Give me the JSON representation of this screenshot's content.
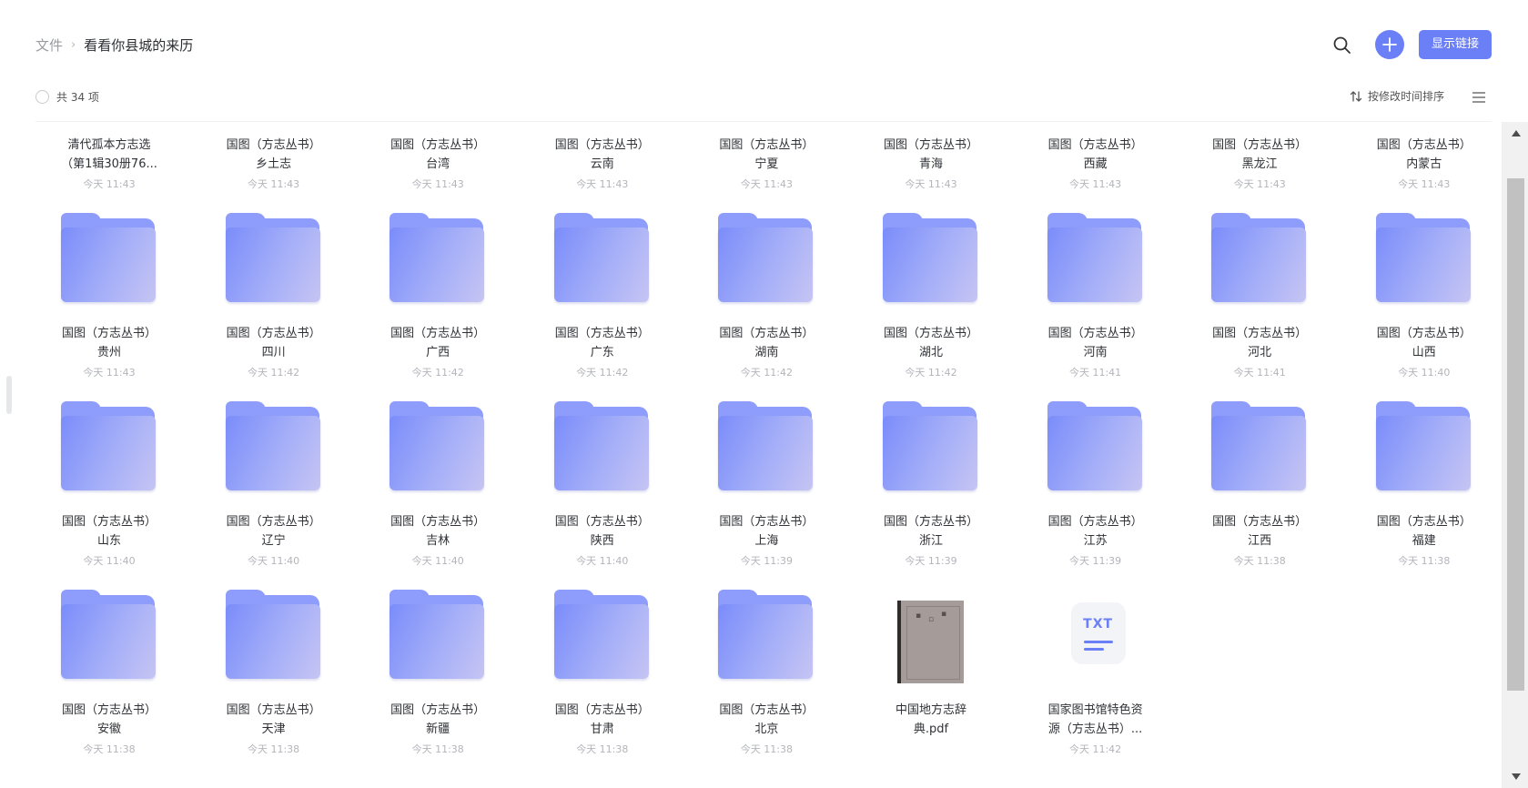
{
  "breadcrumb": {
    "root": "文件",
    "separator": "›",
    "current": "看看你县城的来历"
  },
  "toolbar": {
    "add_symbol": "+",
    "show_link_label": "显示链接",
    "accent": "#6b7ff7"
  },
  "list_header": {
    "count_text": "共 34 项",
    "sort_label": "按修改时间排序"
  },
  "items": [
    {
      "type": "folder",
      "line1": "清代孤本方志选",
      "line2": "（第1辑30册76...",
      "time": "今天 11:43"
    },
    {
      "type": "folder",
      "line1": "国图（方志丛书）",
      "line2": "乡土志",
      "time": "今天 11:43"
    },
    {
      "type": "folder",
      "line1": "国图（方志丛书）",
      "line2": "台湾",
      "time": "今天 11:43"
    },
    {
      "type": "folder",
      "line1": "国图（方志丛书）",
      "line2": "云南",
      "time": "今天 11:43"
    },
    {
      "type": "folder",
      "line1": "国图（方志丛书）",
      "line2": "宁夏",
      "time": "今天 11:43"
    },
    {
      "type": "folder",
      "line1": "国图（方志丛书）",
      "line2": "青海",
      "time": "今天 11:43"
    },
    {
      "type": "folder",
      "line1": "国图（方志丛书）",
      "line2": "西藏",
      "time": "今天 11:43"
    },
    {
      "type": "folder",
      "line1": "国图（方志丛书）",
      "line2": "黑龙江",
      "time": "今天 11:43"
    },
    {
      "type": "folder",
      "line1": "国图（方志丛书）",
      "line2": "内蒙古",
      "time": "今天 11:43"
    },
    {
      "type": "folder",
      "line1": "国图（方志丛书）",
      "line2": "贵州",
      "time": "今天 11:43"
    },
    {
      "type": "folder",
      "line1": "国图（方志丛书）",
      "line2": "四川",
      "time": "今天 11:42"
    },
    {
      "type": "folder",
      "line1": "国图（方志丛书）",
      "line2": "广西",
      "time": "今天 11:42"
    },
    {
      "type": "folder",
      "line1": "国图（方志丛书）",
      "line2": "广东",
      "time": "今天 11:42"
    },
    {
      "type": "folder",
      "line1": "国图（方志丛书）",
      "line2": "湖南",
      "time": "今天 11:42"
    },
    {
      "type": "folder",
      "line1": "国图（方志丛书）",
      "line2": "湖北",
      "time": "今天 11:42"
    },
    {
      "type": "folder",
      "line1": "国图（方志丛书）",
      "line2": "河南",
      "time": "今天 11:41"
    },
    {
      "type": "folder",
      "line1": "国图（方志丛书）",
      "line2": "河北",
      "time": "今天 11:41"
    },
    {
      "type": "folder",
      "line1": "国图（方志丛书）",
      "line2": "山西",
      "time": "今天 11:40"
    },
    {
      "type": "folder",
      "line1": "国图（方志丛书）",
      "line2": "山东",
      "time": "今天 11:40"
    },
    {
      "type": "folder",
      "line1": "国图（方志丛书）",
      "line2": "辽宁",
      "time": "今天 11:40"
    },
    {
      "type": "folder",
      "line1": "国图（方志丛书）",
      "line2": "吉林",
      "time": "今天 11:40"
    },
    {
      "type": "folder",
      "line1": "国图（方志丛书）",
      "line2": "陕西",
      "time": "今天 11:40"
    },
    {
      "type": "folder",
      "line1": "国图（方志丛书）",
      "line2": "上海",
      "time": "今天 11:39"
    },
    {
      "type": "folder",
      "line1": "国图（方志丛书）",
      "line2": "浙江",
      "time": "今天 11:39"
    },
    {
      "type": "folder",
      "line1": "国图（方志丛书）",
      "line2": "江苏",
      "time": "今天 11:39"
    },
    {
      "type": "folder",
      "line1": "国图（方志丛书）",
      "line2": "江西",
      "time": "今天 11:38"
    },
    {
      "type": "folder",
      "line1": "国图（方志丛书）",
      "line2": "福建",
      "time": "今天 11:38"
    },
    {
      "type": "folder",
      "line1": "国图（方志丛书）",
      "line2": "安徽",
      "time": "今天 11:38"
    },
    {
      "type": "folder",
      "line1": "国图（方志丛书）",
      "line2": "天津",
      "time": "今天 11:38"
    },
    {
      "type": "folder",
      "line1": "国图（方志丛书）",
      "line2": "新疆",
      "time": "今天 11:38"
    },
    {
      "type": "folder",
      "line1": "国图（方志丛书）",
      "line2": "甘肃",
      "time": "今天 11:38"
    },
    {
      "type": "folder",
      "line1": "国图（方志丛书）",
      "line2": "北京",
      "time": "今天 11:38"
    },
    {
      "type": "pdf",
      "line1": "中国地方志辞",
      "line2": "典.pdf",
      "time": ""
    },
    {
      "type": "txt",
      "line1": "国家图书馆特色资",
      "line2": "源（方志丛书）...",
      "time": "今天 11:42",
      "icon_label": "TXT"
    }
  ]
}
